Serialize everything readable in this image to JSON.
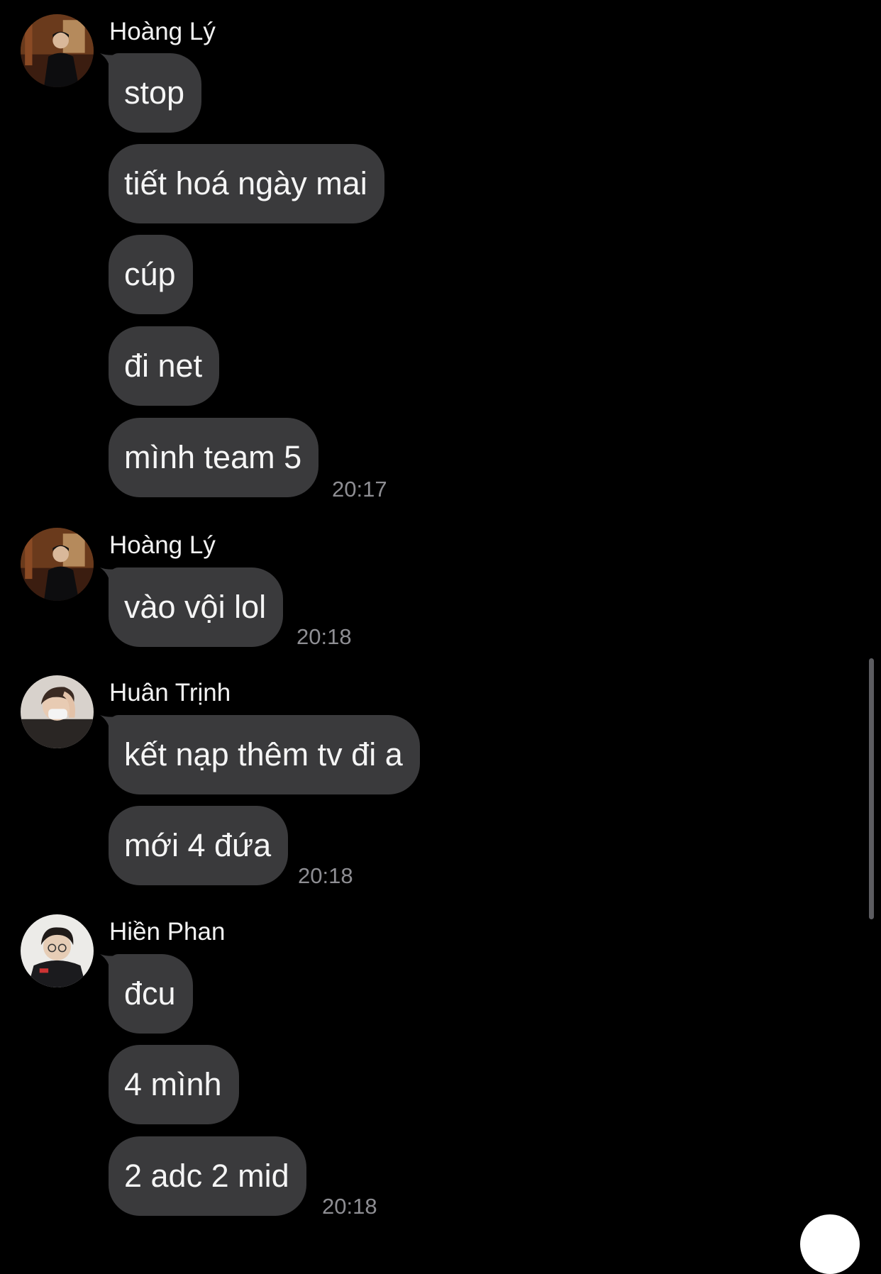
{
  "theme": {
    "background": "#000000",
    "bubble_color": "#3a3a3c",
    "text_color": "#f5f5f5",
    "timestamp_color": "#8e8e93"
  },
  "messages": {
    "group1": {
      "sender": "Hoàng Lý",
      "bubbles": [
        "stop",
        "tiết hoá ngày mai",
        "cúp",
        "đi net",
        "mình team 5"
      ],
      "time": "20:17"
    },
    "group2": {
      "sender": "Hoàng Lý",
      "bubbles": [
        "vào vội lol"
      ],
      "time": "20:18"
    },
    "group3": {
      "sender": "Huân Trịnh",
      "bubbles": [
        "kết nạp thêm tv đi a",
        "mới 4 đứa"
      ],
      "time": "20:18"
    },
    "group4": {
      "sender": "Hiền Phan",
      "bubbles": [
        "đcu",
        "4 mình",
        "2 adc 2 mid"
      ],
      "time": "20:18"
    }
  },
  "icons": {
    "scroll_button": "chevron-down-icon"
  }
}
